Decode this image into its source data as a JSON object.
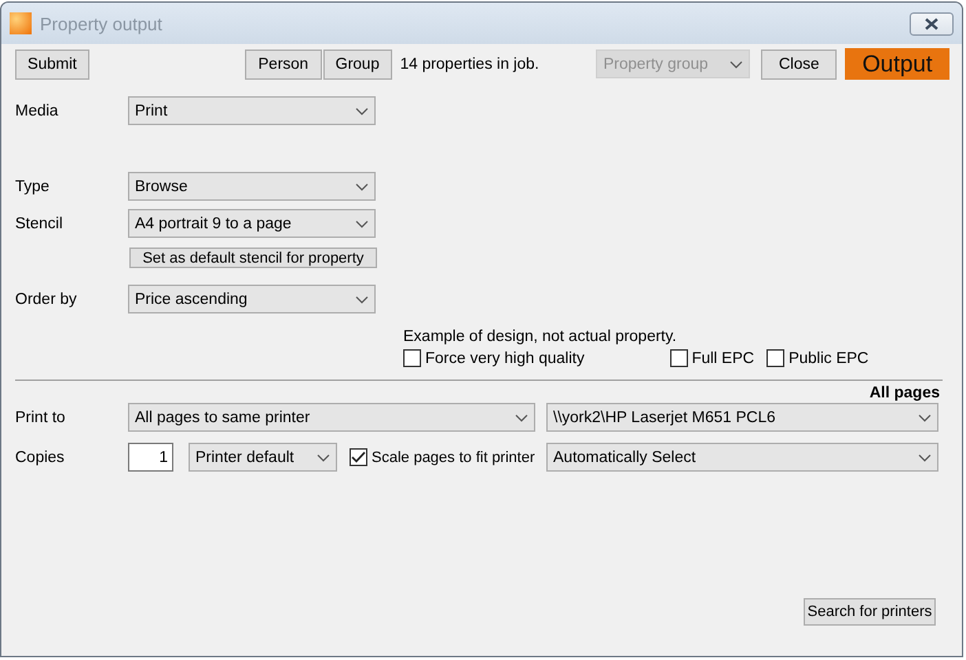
{
  "window": {
    "title": "Property output"
  },
  "toolbar": {
    "submit": "Submit",
    "person": "Person",
    "group": "Group",
    "count": "14 properties in job.",
    "property_group": {
      "value": "Property group",
      "disabled": true
    },
    "close": "Close",
    "output": "Output"
  },
  "fields": [
    {
      "label": "Media",
      "value": "Print"
    },
    {
      "label": "Type",
      "value": "Browse"
    },
    {
      "label": "Stencil",
      "value": "A4 portrait 9 to a page",
      "button": "Set as default stencil for property"
    },
    {
      "label": "Order by",
      "value": "Price ascending"
    }
  ],
  "example_note": "Example of design, not actual property.",
  "options": [
    {
      "label": "Force very high quality",
      "checked": false
    },
    {
      "label": "Full EPC",
      "checked": false
    },
    {
      "label": "Public EPC",
      "checked": false
    }
  ],
  "pages_heading": "All pages",
  "print_to": {
    "label": "Print to",
    "value": "All pages to same printer",
    "printer": "\\\\york2\\HP Laserjet M651 PCL6"
  },
  "copies": {
    "label": "Copies",
    "value": "1",
    "size": "Printer default",
    "scale": {
      "label": "Scale pages to fit printer",
      "checked": true
    },
    "tray": "Automatically Select"
  },
  "search_button": "Search for printers"
}
